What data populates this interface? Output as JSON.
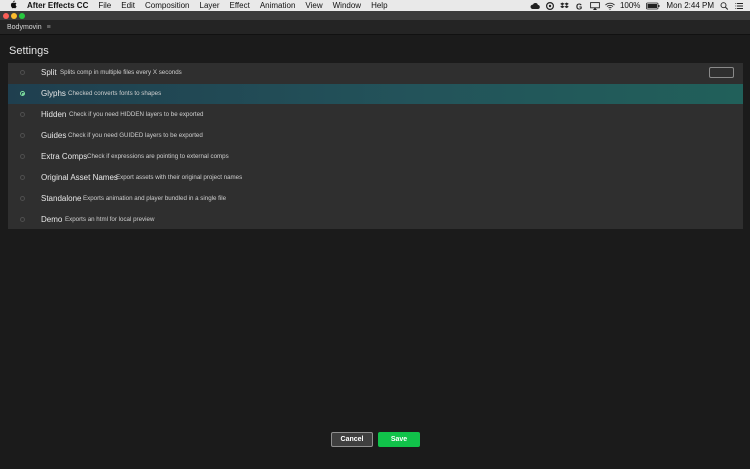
{
  "menubar": {
    "apple_icon": "apple-logo-icon",
    "items": [
      "After Effects CC",
      "File",
      "Edit",
      "Composition",
      "Layer",
      "Effect",
      "Animation",
      "View",
      "Window",
      "Help"
    ],
    "battery": "100%",
    "clock": "Mon 2:44 PM"
  },
  "panel": {
    "title": "Bodymovin",
    "menu_icon": "≡"
  },
  "settings": {
    "title": "Settings",
    "options": [
      {
        "name": "Split",
        "desc": "Splits comp in multiple files every X seconds",
        "selected": false
      },
      {
        "name": "Glyphs",
        "desc": "Checked converts fonts to shapes",
        "selected": true
      },
      {
        "name": "Hidden",
        "desc": "Check if you need HIDDEN layers to be exported",
        "selected": false
      },
      {
        "name": "Guides",
        "desc": "Check if you need GUIDED layers to be exported",
        "selected": false
      },
      {
        "name": "Extra Comps",
        "desc": "Check if expressions are pointing to external comps",
        "selected": false
      },
      {
        "name": "Original Asset Names",
        "desc": "Export assets with their original project names",
        "selected": false
      },
      {
        "name": "Standalone",
        "desc": "Exports animation and player bundled in a single file",
        "selected": false
      },
      {
        "name": "Demo",
        "desc": "Exports an html for local preview",
        "selected": false
      }
    ],
    "split_value": ""
  },
  "buttons": {
    "cancel": "Cancel",
    "save": "Save"
  },
  "colors": {
    "accent_green": "#11c24a",
    "active_row": "#23535a"
  }
}
